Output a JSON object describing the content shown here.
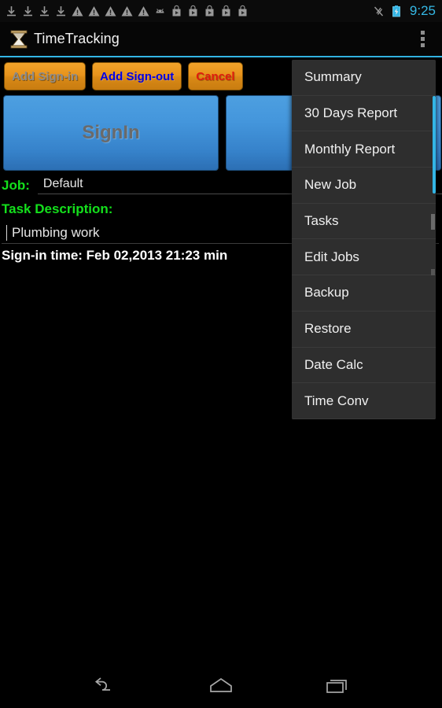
{
  "status_bar": {
    "icons": [
      {
        "name": "download-icon"
      },
      {
        "name": "download-icon"
      },
      {
        "name": "download-icon"
      },
      {
        "name": "download-icon"
      },
      {
        "name": "warning-triangle-icon"
      },
      {
        "name": "warning-triangle-icon"
      },
      {
        "name": "warning-triangle-icon"
      },
      {
        "name": "warning-triangle-icon"
      },
      {
        "name": "warning-triangle-icon"
      },
      {
        "name": "android-head-icon"
      },
      {
        "name": "play-store-icon"
      },
      {
        "name": "play-store-icon"
      },
      {
        "name": "play-store-icon"
      },
      {
        "name": "play-store-icon"
      },
      {
        "name": "play-store-icon"
      }
    ],
    "mute_icon": "silent-mode-icon",
    "battery_icon": "battery-charging-icon",
    "clock": "9:25",
    "accent_color": "#33b5e5"
  },
  "action_bar": {
    "app_icon": "hourglass-icon",
    "title": "TimeTracking",
    "overflow_icon": "overflow-menu-icon"
  },
  "toolbar": {
    "buttons": [
      {
        "label": "Add Sign-in",
        "state": "disabled",
        "text_color": "#8c8c8c"
      },
      {
        "label": "Add Sign-out",
        "state": "enabled",
        "text_color": "#0000e6"
      },
      {
        "label": "Cancel",
        "state": "enabled",
        "text_color": "#e01b0e"
      }
    ]
  },
  "main": {
    "signin_button_label": "SignIn",
    "signout_button_label": "",
    "job": {
      "label": "Job:",
      "value": "Default"
    },
    "task": {
      "label": "Task Description:",
      "value": "Plumbing work",
      "placeholder": ""
    },
    "signin_time": "Sign-in time: Feb 02,2013 21:23 min"
  },
  "overflow_menu": {
    "items": [
      {
        "label": "Summary"
      },
      {
        "label": "30 Days Report"
      },
      {
        "label": "Monthly Report"
      },
      {
        "label": "New Job"
      },
      {
        "label": "Tasks"
      },
      {
        "label": "Edit Jobs"
      },
      {
        "label": "Backup"
      },
      {
        "label": "Restore"
      },
      {
        "label": "Date Calc"
      },
      {
        "label": "Time Conv"
      }
    ],
    "scrollbar_color": "#33b5e5"
  },
  "nav_bar": {
    "back": "back-icon",
    "home": "home-icon",
    "recents": "recents-icon"
  },
  "colors": {
    "accent": "#33b5e5",
    "label_green": "#14e01c",
    "button_amber": "#e8931c",
    "button_blue": "#4496dc",
    "background": "#000000",
    "menu_background": "#2e2e2e"
  }
}
